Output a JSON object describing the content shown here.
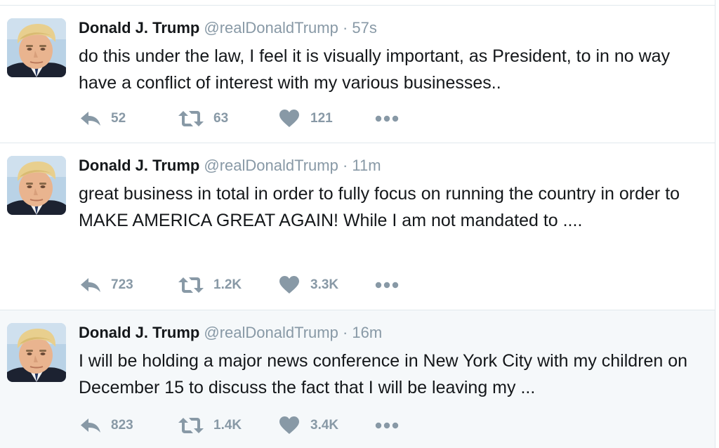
{
  "colors": {
    "name": "#14171a",
    "meta": "#8899a6",
    "divider": "#e1e8ed",
    "highlight_bg": "#f5f8fa"
  },
  "tweets": [
    {
      "name": "Donald J. Trump",
      "handle": "@realDonaldTrump",
      "separator": "·",
      "time": "57s",
      "text": "do this under the law, I feel it is visually important, as President,  to in no way have a conflict of interest with my various businesses..",
      "replies": "52",
      "retweets": "63",
      "likes": "121",
      "more_icon": "more-dots-icon"
    },
    {
      "name": "Donald J. Trump",
      "handle": "@realDonaldTrump",
      "separator": "·",
      "time": "11m",
      "text": "great business in total in order to fully focus on running the country in order to MAKE AMERICA GREAT AGAIN! While I am not mandated to ....",
      "replies": "723",
      "retweets": "1.2K",
      "likes": "3.3K",
      "more_icon": "more-dots-icon"
    },
    {
      "name": "Donald J. Trump",
      "handle": "@realDonaldTrump",
      "separator": "·",
      "time": "16m",
      "text": "I will be holding a major news conference in New York City with my children on December 15 to discuss the fact that I will be leaving my ...",
      "replies": "823",
      "retweets": "1.4K",
      "likes": "3.4K",
      "more_icon": "more-dots-icon"
    }
  ]
}
